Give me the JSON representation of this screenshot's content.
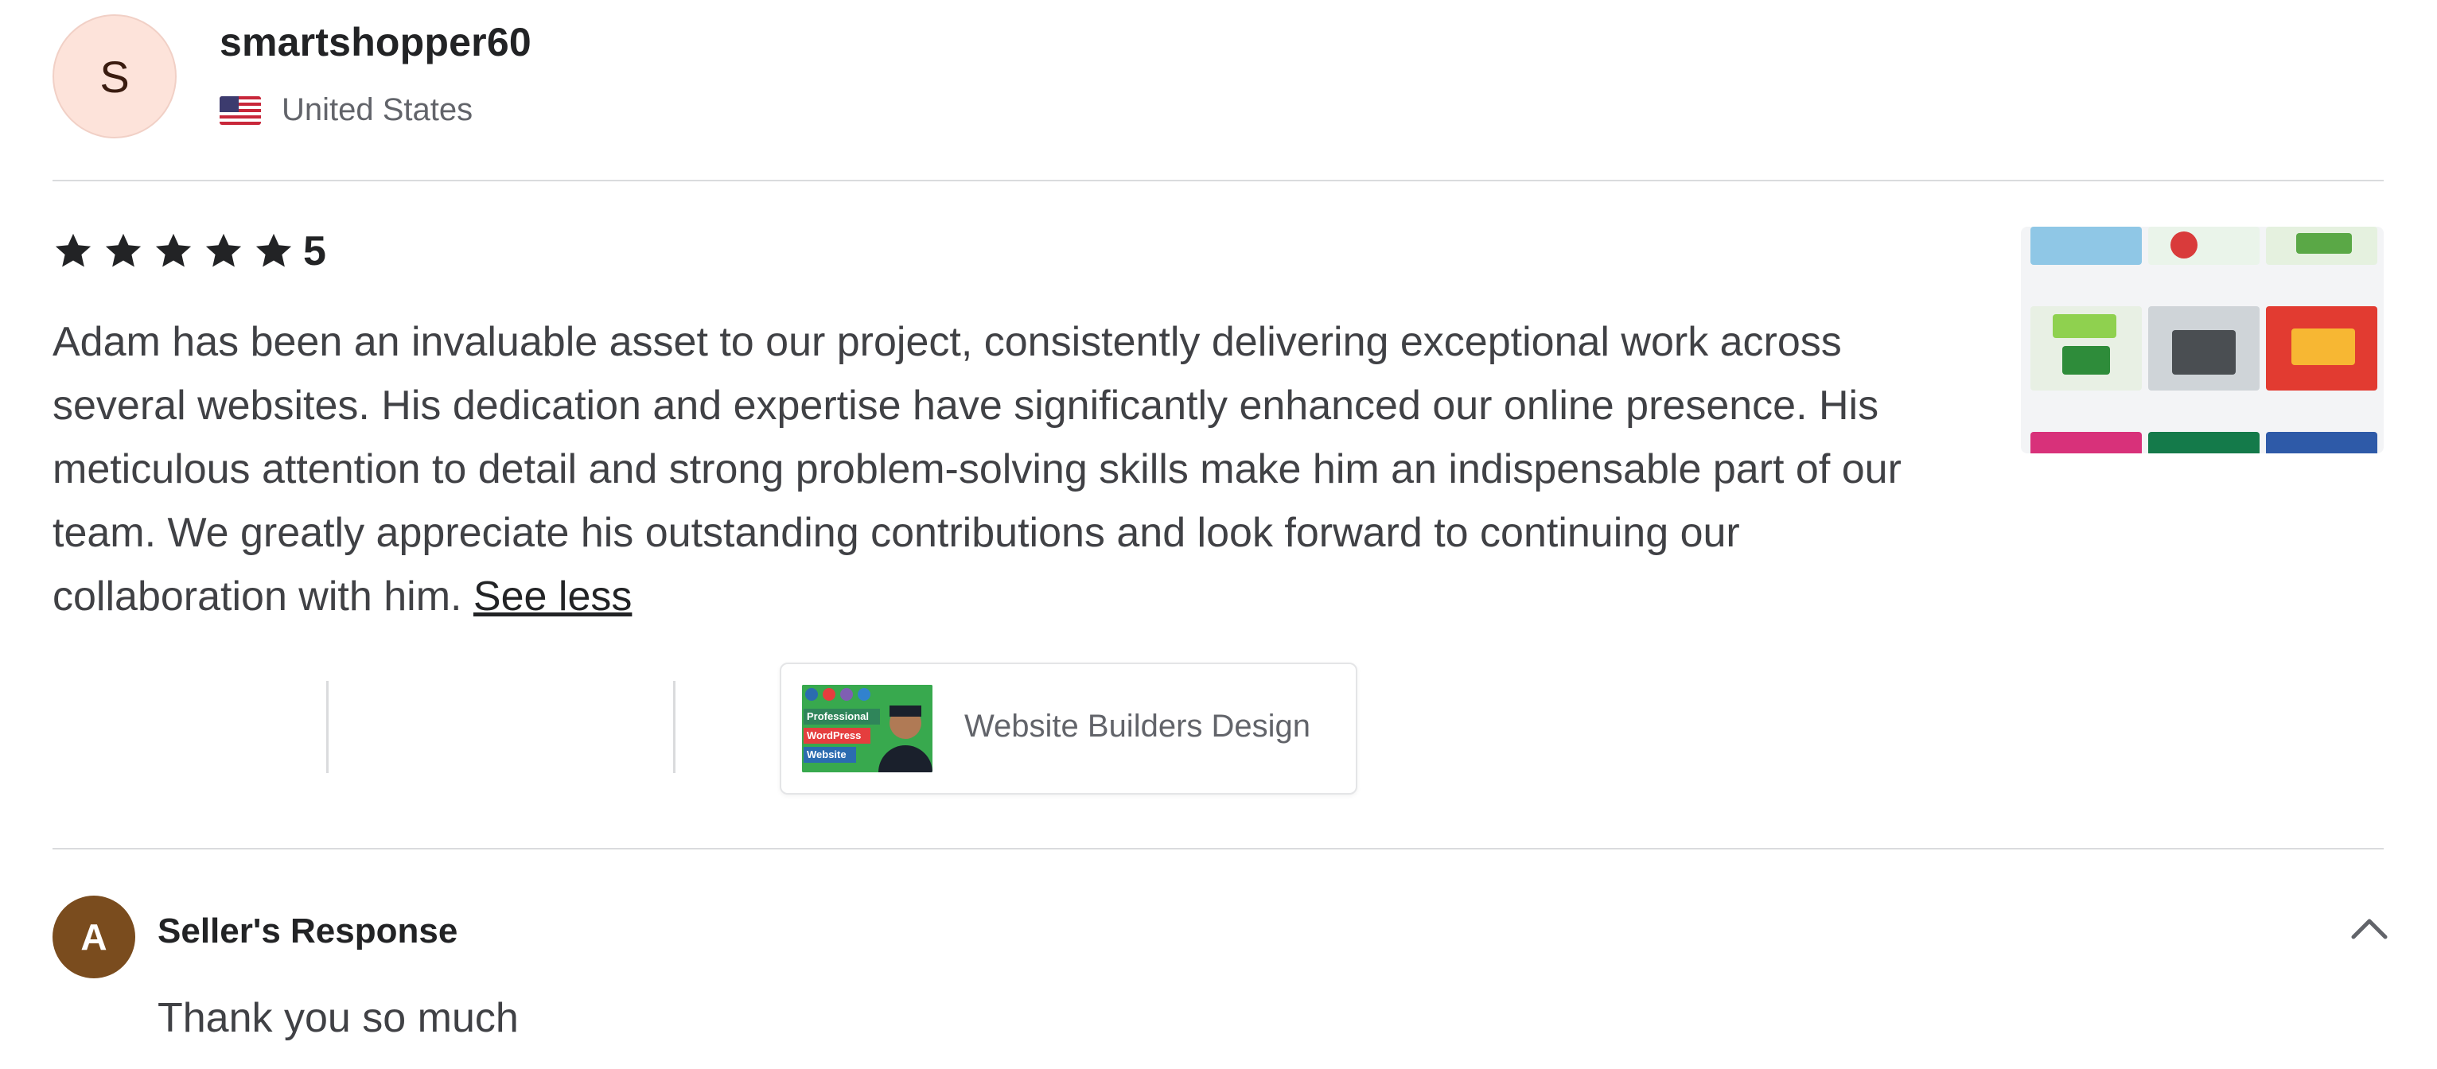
{
  "reviewer": {
    "initial": "S",
    "username": "smartshopper60",
    "country": "United States",
    "flag_icon": "us-flag-icon"
  },
  "review": {
    "rating": "5",
    "stars": 5,
    "text": "Adam has been an invaluable asset to our project, consistently delivering exceptional work across several websites. His dedication and expertise have significantly enhanced our online presence. His meticulous attention to detail and strong problem-solving skills make him an indispensable part of our team. We greatly appreciate his outstanding contributions and look forward to continuing our collaboration with him.",
    "see_less": "See less"
  },
  "gig": {
    "title": "Website Builders Design",
    "image_text": [
      "Professional",
      "WordPress",
      "Website"
    ]
  },
  "seller_response": {
    "initial": "A",
    "title": "Seller's Response",
    "text": "Thank you so much",
    "toggle_icon": "chevron-up-icon"
  },
  "colors": {
    "avatar_bg": "#fde3da",
    "seller_avatar_bg": "#7a4c1e",
    "text_primary": "#222325",
    "text_secondary": "#62646a",
    "divider": "#dadbdd"
  }
}
